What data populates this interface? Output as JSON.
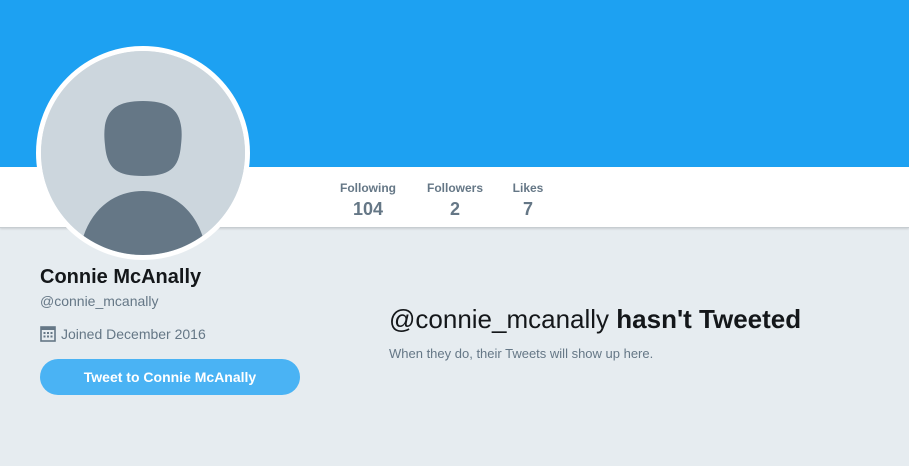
{
  "colors": {
    "banner": "#1da1f2",
    "page_bg": "#e6ecf0",
    "button": "#4ab3f4",
    "muted_text": "#657786",
    "primary_text": "#14171a"
  },
  "nav": {
    "stats": [
      {
        "label": "Following",
        "value": "104"
      },
      {
        "label": "Followers",
        "value": "2"
      },
      {
        "label": "Likes",
        "value": "7"
      }
    ]
  },
  "profile": {
    "name": "Connie McAnally",
    "handle": "@connie_mcanally",
    "joined": "Joined December 2016",
    "joined_icon": "calendar-icon",
    "avatar_icon": "default-avatar-icon",
    "tweet_button_label": "Tweet to Connie McAnally"
  },
  "timeline": {
    "empty_handle": "@connie_mcanally",
    "empty_title_suffix": "hasn't Tweeted",
    "empty_subtitle": "When they do, their Tweets will show up here."
  }
}
